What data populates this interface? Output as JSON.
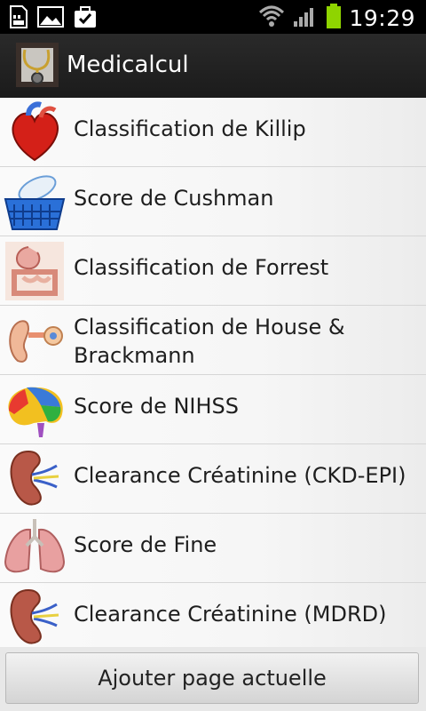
{
  "status_bar": {
    "time": "19:29",
    "icons": [
      "sd-card-icon",
      "image-icon",
      "briefcase-check-icon",
      "wifi-icon",
      "signal-icon",
      "battery-icon"
    ]
  },
  "action_bar": {
    "title": "Medicalcul",
    "icon": "stethoscope-app-icon"
  },
  "list": {
    "items": [
      {
        "label": "Classification de Killip",
        "icon": "heart-icon"
      },
      {
        "label": "Score de Cushman",
        "icon": "pill-basket-icon"
      },
      {
        "label": "Classification de Forrest",
        "icon": "digestive-system-icon"
      },
      {
        "label": "Classification de House & Brackmann",
        "icon": "ear-icon"
      },
      {
        "label": "Score de NIHSS",
        "icon": "brain-icon"
      },
      {
        "label": "Clearance Créatinine (CKD-EPI)",
        "icon": "kidney-icon"
      },
      {
        "label": "Score de Fine",
        "icon": "lungs-icon"
      },
      {
        "label": "Clearance Créatinine (MDRD)",
        "icon": "kidney-icon"
      }
    ]
  },
  "footer": {
    "button_label": "Ajouter page actuelle"
  },
  "colors": {
    "status_bar_bg": "#000000",
    "action_bar_bg": "#222222",
    "battery": "#8fd400",
    "list_bg": "#f6f6f6",
    "divider": "#d6d6d6"
  }
}
